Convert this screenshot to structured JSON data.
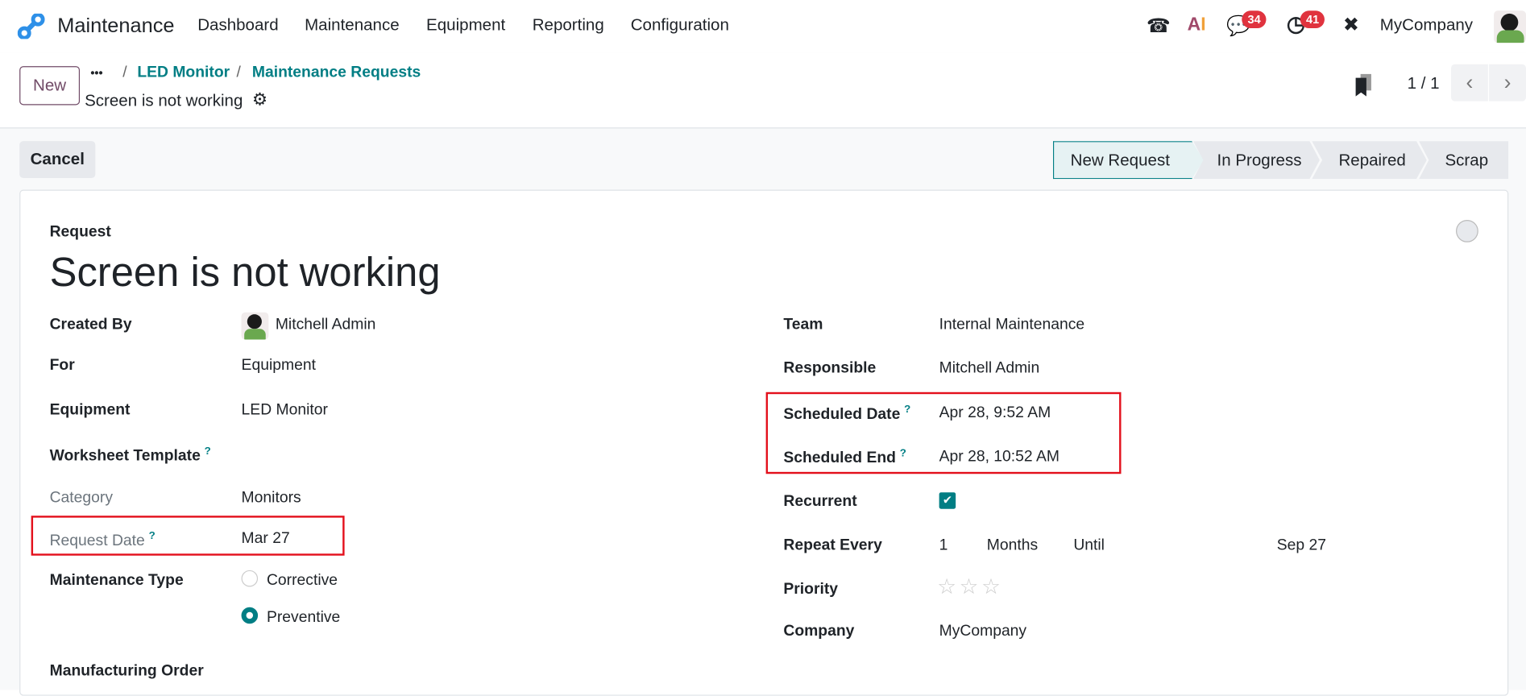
{
  "nav": {
    "app": "Maintenance",
    "menu": [
      "Dashboard",
      "Maintenance",
      "Equipment",
      "Reporting",
      "Configuration"
    ],
    "chat_count": "34",
    "activity_count": "41",
    "company": "MyCompany",
    "icons": [
      "phone-icon",
      "ai-icon",
      "chat-icon",
      "clock-icon",
      "tools-icon"
    ]
  },
  "control": {
    "new_label": "New",
    "ellipsis": "•••",
    "breadcrumbs": [
      "LED Monitor",
      "Maintenance Requests"
    ],
    "record": "Screen is not working",
    "pager": "1 / 1"
  },
  "actions": {
    "cancel": "Cancel"
  },
  "stages": {
    "items": [
      "New Request",
      "In Progress",
      "Repaired",
      "Scrap"
    ],
    "active": "New Request"
  },
  "form": {
    "section": "Request",
    "title": "Screen is not working",
    "left": {
      "created_by_label": "Created By",
      "created_by": "Mitchell Admin",
      "for_label": "For",
      "for": "Equipment",
      "equipment_label": "Equipment",
      "equipment": "LED Monitor",
      "worksheet_label": "Worksheet Template",
      "category_label": "Category",
      "category": "Monitors",
      "request_date_label": "Request Date",
      "request_date": "Mar 27",
      "maint_type_label": "Maintenance Type",
      "maint_types": [
        "Corrective",
        "Preventive"
      ],
      "maint_type_selected": "Preventive",
      "mo_label": "Manufacturing Order"
    },
    "right": {
      "team_label": "Team",
      "team": "Internal Maintenance",
      "responsible_label": "Responsible",
      "responsible": "Mitchell Admin",
      "sched_date_label": "Scheduled Date",
      "sched_date": "Apr 28, 9:52 AM",
      "sched_end_label": "Scheduled End",
      "sched_end": "Apr 28, 10:52 AM",
      "recurrent_label": "Recurrent",
      "recurrent": true,
      "repeat_label": "Repeat Every",
      "repeat_interval": "1",
      "repeat_unit": "Months",
      "until_label": "Until",
      "until": "Sep 27",
      "priority_label": "Priority",
      "priority": 0,
      "company_label": "Company",
      "company": "MyCompany"
    },
    "help_mark": "?"
  },
  "colors": {
    "accent": "#017e84",
    "badge": "#e0333e",
    "highlight": "#e3101c"
  }
}
